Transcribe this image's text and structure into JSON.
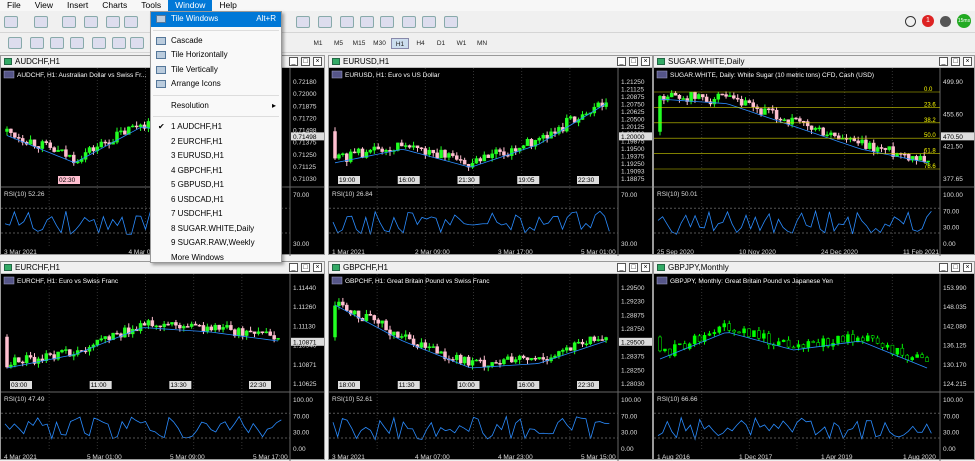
{
  "menubar": [
    "File",
    "View",
    "Insert",
    "Charts",
    "Tools",
    "Window",
    "Help"
  ],
  "menubar_active": "Window",
  "timeframes": [
    "M1",
    "M5",
    "M15",
    "M30",
    "H1",
    "H4",
    "D1",
    "W1",
    "MN"
  ],
  "timeframe_selected": "H1",
  "window_menu": {
    "tile_windows": "Tile Windows",
    "tile_windows_shortcut": "Alt+R",
    "cascade": "Cascade",
    "tile_horizontally": "Tile Horizontally",
    "tile_vertically": "Tile Vertically",
    "arrange_icons": "Arrange Icons",
    "resolution": "Resolution",
    "windows": [
      "1 AUDCHF,H1",
      "2 EURCHF,H1",
      "3 EURUSD,H1",
      "4 GBPCHF,H1",
      "5 GBPUSD,H1",
      "6 USDCAD,H1",
      "7 USDCHF,H1",
      "8 SUGAR.WHITE,Daily",
      "9 SUGAR.RAW,Weekly"
    ],
    "more": "More Windows"
  },
  "status": {
    "alert_count": "1",
    "latency": "15ms"
  },
  "charts": [
    {
      "title": "AUDCHF,H1",
      "subtitle": "AUDCHF, H1:  Australian Dollar vs Swiss Fr...",
      "rsi": "RSI(10) 52.26",
      "prices": [
        "0.72180",
        "0.72000",
        "0.71875",
        "0.71720",
        "0.71498",
        "0.71375",
        "0.71250",
        "0.71125",
        "0.71030"
      ],
      "current": "0.71498",
      "rsi_levels": [
        "70.00",
        "30.00"
      ],
      "dates": [
        "3 Mar 2021",
        "4 Mar 05:00",
        "4 Mar ..."
      ],
      "marker": "02:30"
    },
    {
      "title": "EURUSD,H1",
      "subtitle": "EURUSD, H1:  Euro vs US Dollar",
      "rsi": "RSI(10) 26.84",
      "prices": [
        "1.21250",
        "1.21125",
        "1.20875",
        "1.20750",
        "1.20625",
        "1.20500",
        "1.20125",
        "1.20000",
        "1.19875",
        "1.19500",
        "1.19375",
        "1.19250",
        "1.19093",
        "1.18875"
      ],
      "current": "1.20000",
      "rsi_levels": [
        "70.00",
        "30.00"
      ],
      "dates": [
        "1 Mar 2021",
        "2 Mar 09:00",
        "3 Mar 17:00",
        "5 Mar 01:00"
      ],
      "markers": [
        "19:00",
        "16:00",
        "21:30",
        "19:05",
        "22:30"
      ]
    },
    {
      "title": "SUGAR.WHITE,Daily",
      "subtitle": "SUGAR.WHITE, Daily:  White Sugar (10 metric tons) CFD, Cash (USD)",
      "rsi": "RSI(10) 50.01",
      "prices": [
        "499.90",
        "455.60",
        "421.50",
        "377.65"
      ],
      "current": "470.50",
      "fib": [
        "0.0",
        "23.6",
        "38.2",
        "50.0",
        "61.8",
        "78.6"
      ],
      "rsi_levels": [
        "100.00",
        "70.00",
        "30.00",
        "0.00"
      ],
      "dates": [
        "25 Sep 2020",
        "10 Nov 2020",
        "24 Dec 2020",
        "11 Feb 2021"
      ]
    },
    {
      "title": "EURCHF,H1",
      "subtitle": "EURCHF, H1:  Euro vs Swiss Franc",
      "rsi": "RSI(10) 47.49",
      "prices": [
        "1.11440",
        "1.11260",
        "1.11130",
        "1.10940",
        "1.10871",
        "1.10625"
      ],
      "current": "1.10871",
      "rsi_levels": [
        "100.00",
        "70.00",
        "30.00",
        "0.00"
      ],
      "dates": [
        "4 Mar 2021",
        "5 Mar 01:00",
        "5 Mar 09:00",
        "5 Mar 17:00"
      ],
      "markers": [
        "03:00",
        "11:00",
        "13:30",
        "22:30"
      ]
    },
    {
      "title": "GBPCHF,H1",
      "subtitle": "GBPCHF, H1:  Great Britain Pound vs Swiss Franc",
      "rsi": "RSI(10) 52.61",
      "prices": [
        "1.29500",
        "1.29230",
        "1.28875",
        "1.28750",
        "1.28625",
        "1.28375",
        "1.28250",
        "1.28030"
      ],
      "current": "1.29500",
      "rsi_levels": [
        "100.00",
        "70.00",
        "30.00",
        "0.00"
      ],
      "dates": [
        "3 Mar 2021",
        "4 Mar 07:00",
        "4 Mar 23:00",
        "5 Mar 15:00"
      ],
      "markers": [
        "18:00",
        "11:30",
        "10:00",
        "16:00",
        "22:30"
      ]
    },
    {
      "title": "GBPJPY,Monthly",
      "subtitle": "GBPJPY, Monthly:  Great Britain Pound vs Japanese Yen",
      "rsi": "RSI(10) 66.66",
      "prices": [
        "153.990",
        "148.035",
        "142.080",
        "136.125",
        "130.170",
        "124.215"
      ],
      "rsi_levels": [
        "100.00",
        "70.00",
        "30.00",
        "0.00"
      ],
      "dates": [
        "1 Aug 2016",
        "1 Dec 2017",
        "1 Apr 2019",
        "1 Aug 2020"
      ]
    }
  ]
}
